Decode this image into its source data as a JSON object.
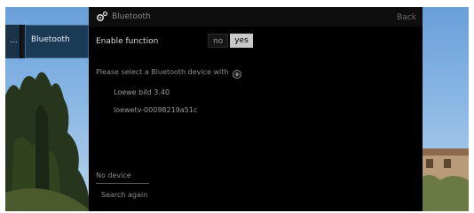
{
  "window": {
    "title": "Bluetooth",
    "back_label": "Back"
  },
  "left_menu": {
    "overflow_label": "...",
    "selected_label": "Bluetooth"
  },
  "enable": {
    "label": "Enable function",
    "options": [
      "no",
      "yes"
    ],
    "selected": "yes"
  },
  "instruction": "Please select a Bluetooth device with",
  "devices": [
    "Loewe bild 3.40",
    "loewetv-00098219a51c"
  ],
  "status": "No device",
  "search_again_label": "Search again",
  "colors": {
    "panel": "#000000",
    "selected_menu": "#1b3a55",
    "toggle_selected": "#c9c9c9"
  }
}
